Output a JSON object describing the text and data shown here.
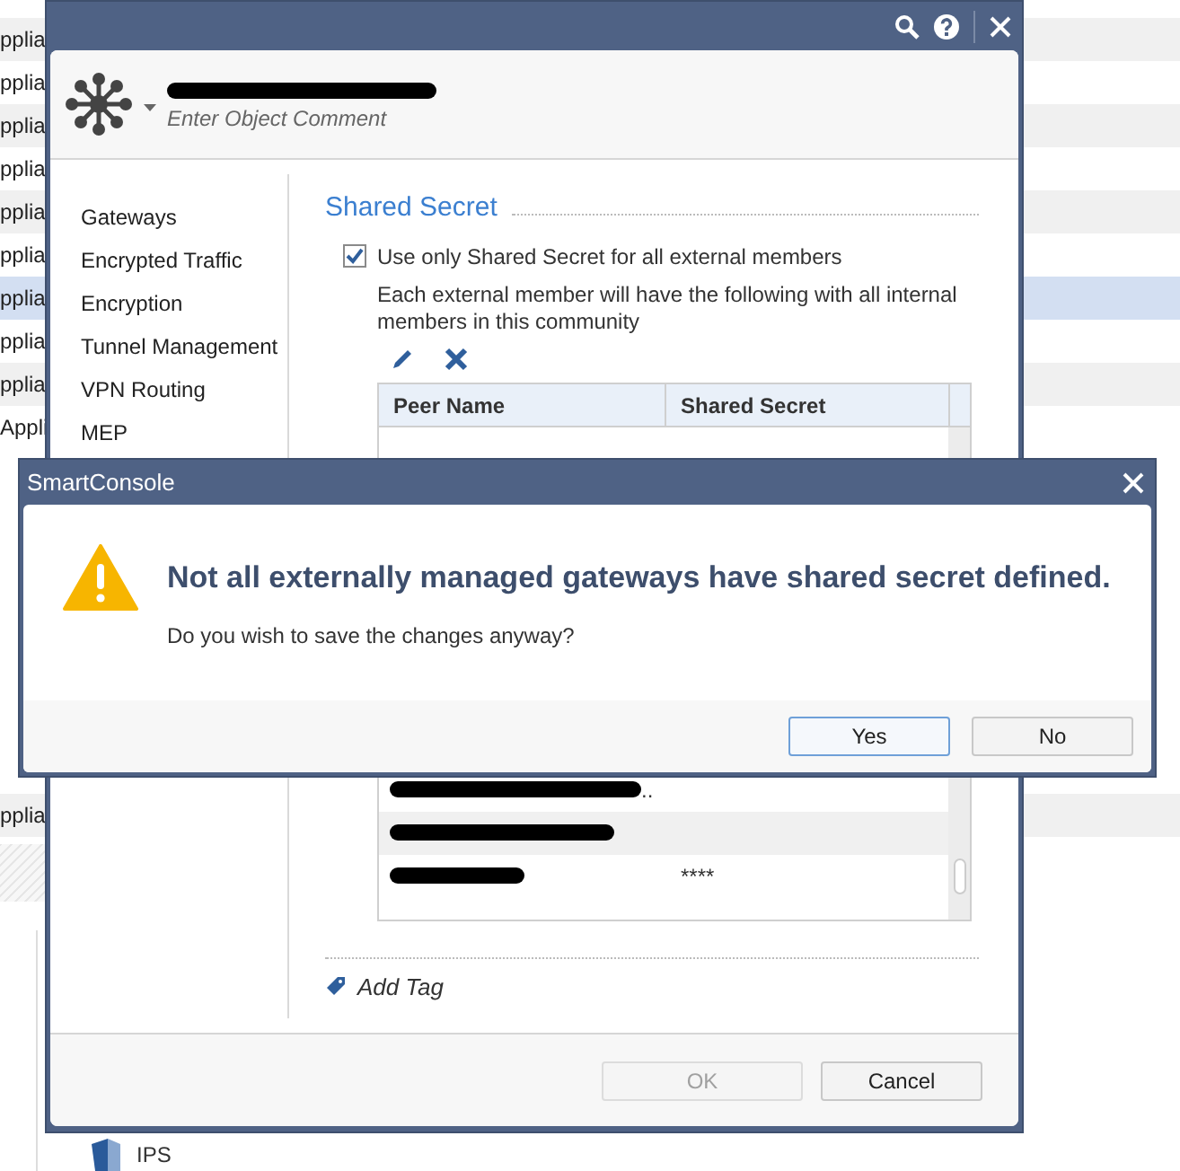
{
  "background_list": {
    "rows": [
      {
        "text": "pplia",
        "selected": false
      },
      {
        "text": "pplia",
        "selected": false
      },
      {
        "text": "pplia",
        "selected": false
      },
      {
        "text": "pplia",
        "selected": false
      },
      {
        "text": "pplia",
        "selected": false
      },
      {
        "text": "pplia",
        "selected": false
      },
      {
        "text": "pplia",
        "selected": true
      },
      {
        "text": "pplia",
        "selected": false
      },
      {
        "text": "pplia",
        "selected": false
      },
      {
        "text": "Appli",
        "selected": false
      }
    ],
    "rows_below": [
      {
        "text": "pplia",
        "selected": false
      }
    ],
    "tree_item": "IPS"
  },
  "object_window": {
    "header": {
      "object_name": {
        "kind": "redacted"
      },
      "comment_placeholder": "Enter Object Comment"
    },
    "sidebar": {
      "items": [
        "Gateways",
        "Encrypted Traffic",
        "Encryption",
        "Tunnel Management",
        "VPN Routing",
        "MEP"
      ]
    },
    "section_title": "Shared Secret",
    "checkbox": {
      "label": "Use only Shared Secret for all external members",
      "checked": true
    },
    "description": "Each external member will have the following with all internal members in this community",
    "table": {
      "columns": [
        "Peer Name",
        "Shared Secret"
      ],
      "rows_below": [
        {
          "kind": "redacted",
          "suffix": ".."
        },
        {
          "kind": "redacted"
        },
        {
          "kind": "redacted",
          "shared_secret": "****"
        }
      ]
    },
    "add_tag": "Add Tag",
    "buttons": [
      {
        "label": "OK",
        "disabled": true
      },
      {
        "label": "Cancel",
        "disabled": false
      }
    ]
  },
  "dialog": {
    "title": "SmartConsole",
    "heading": "Not all externally managed gateways have shared secret defined.",
    "message": "Do you wish to save the changes anyway?",
    "buttons": [
      {
        "label": "Yes",
        "selected": true
      },
      {
        "label": "No",
        "selected": false
      }
    ]
  }
}
